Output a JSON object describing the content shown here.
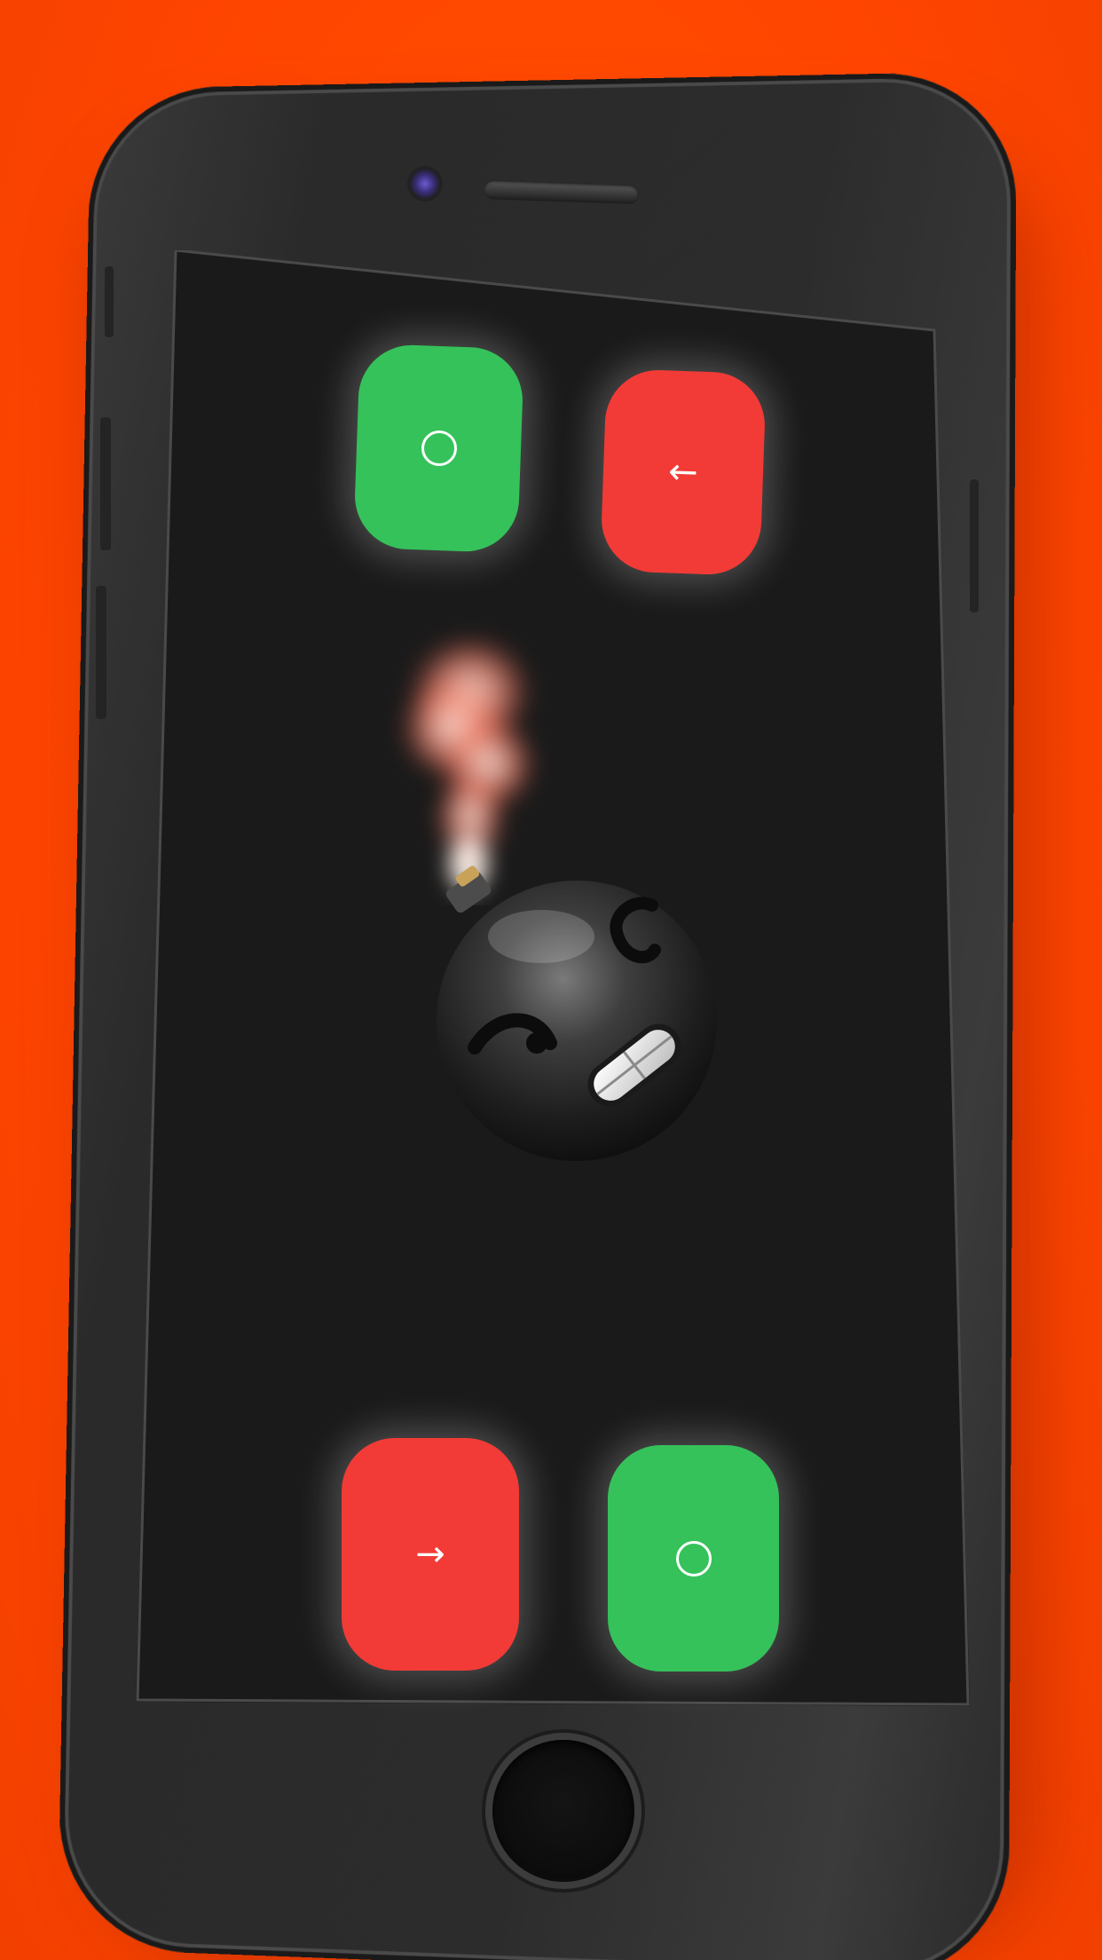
{
  "app": {
    "accent_background": "#ff4a00",
    "screen_background": "#1a1a1a"
  },
  "tiles": {
    "top_left": {
      "color": "#35c25a",
      "icon": "circle-icon"
    },
    "top_right": {
      "color": "#f23b36",
      "icon": "arrow-left-icon",
      "glyph": "←"
    },
    "bottom_left": {
      "color": "#f23b36",
      "icon": "arrow-right-icon",
      "glyph": "→"
    },
    "bottom_right": {
      "color": "#35c25a",
      "icon": "circle-icon"
    }
  },
  "center": {
    "icon": "bomb-icon"
  },
  "device": {
    "home_button_icon": "home-button"
  }
}
